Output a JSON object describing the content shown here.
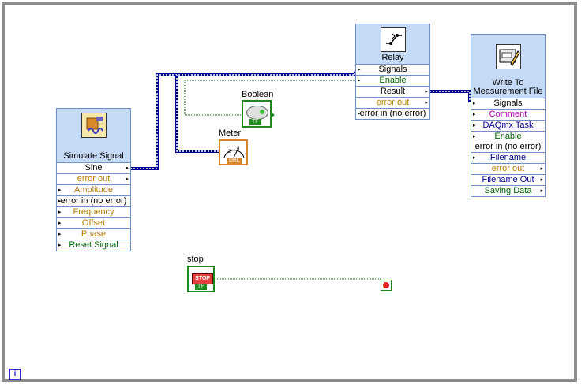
{
  "simulate_signal": {
    "title": "Simulate Signal",
    "terminals": [
      "Sine",
      "error out",
      "Amplitude",
      "error in (no error)",
      "Frequency",
      "Offset",
      "Phase",
      "Reset Signal"
    ]
  },
  "relay": {
    "title": "Relay",
    "terminals": [
      "Signals",
      "Enable",
      "Result",
      "error out",
      "error in (no error)"
    ]
  },
  "write_file": {
    "title_line1": "Write To",
    "title_line2": "Measurement File",
    "terminals": [
      "Signals",
      "Comment",
      "DAQmx Task",
      "Enable",
      "error in (no error)",
      "Filename",
      "error out",
      "Filename Out",
      "Saving Data"
    ]
  },
  "boolean": {
    "label": "Boolean",
    "type": "TF"
  },
  "meter": {
    "label": "Meter",
    "type": "DBL"
  },
  "stop": {
    "label": "stop",
    "button_text": "STOP",
    "type": "TF"
  },
  "loop_iteration": {
    "symbol": "i"
  },
  "colors": {
    "dynamic_wire": "#00008c",
    "boolean_wire": "#006000",
    "node_header": "#c5daf6",
    "node_border": "#6f8ecb",
    "loop_border": "#8c8c8c"
  }
}
